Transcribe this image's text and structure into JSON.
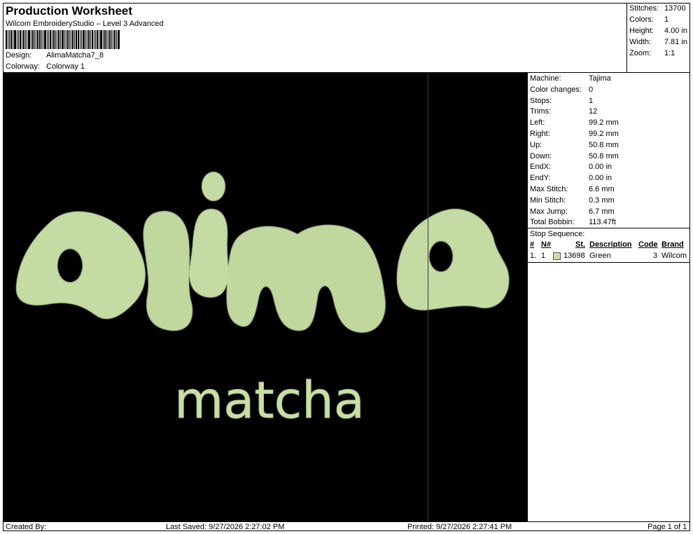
{
  "header": {
    "title": "Production Worksheet",
    "subtitle": "Wilcom EmbroideryStudio – Level 3 Advanced",
    "design_label": "Design:",
    "design_value": "AlimaMatcha7_8",
    "colorway_label": "Colorway:",
    "colorway_value": "Colorway 1"
  },
  "summary": {
    "stitches_label": "Stitches:",
    "stitches_value": "13700",
    "colors_label": "Colors:",
    "colors_value": "1",
    "height_label": "Height:",
    "height_value": "4.00 in",
    "width_label": "Width:",
    "width_value": "7.81 in",
    "zoom_label": "Zoom:",
    "zoom_value": "1:1"
  },
  "machine_info": [
    {
      "label": "Machine:",
      "value": "Tajima"
    },
    {
      "label": "Color changes:",
      "value": "0"
    },
    {
      "label": "Stops:",
      "value": "1"
    },
    {
      "label": "Trims:",
      "value": "12"
    },
    {
      "label": "Left:",
      "value": "99.2 mm"
    },
    {
      "label": "Right:",
      "value": "99.2 mm"
    },
    {
      "label": "Up:",
      "value": "50.8 mm"
    },
    {
      "label": "Down:",
      "value": "50.8 mm"
    },
    {
      "label": "EndX:",
      "value": "0.00 in"
    },
    {
      "label": "EndY:",
      "value": "0.00 in"
    },
    {
      "label": "Max Stitch:",
      "value": "6.6 mm"
    },
    {
      "label": "Min Stitch:",
      "value": "0.3 mm"
    },
    {
      "label": "Max Jump:",
      "value": "6.7 mm"
    },
    {
      "label": "Total Bobbin:",
      "value": "113.47ft"
    }
  ],
  "stop_sequence": {
    "title": "Stop Sequence:",
    "columns": [
      "#",
      "N#",
      "St.",
      "Description",
      "Code",
      "Brand"
    ],
    "rows": [
      {
        "index": "1.",
        "n": "1",
        "stitches": "13698",
        "description": "Green",
        "code": "3",
        "brand": "Wilcom",
        "swatch_color": "#c8dfa8"
      }
    ]
  },
  "design": {
    "main_text": "alima",
    "sub_text": "matcha",
    "thread_color": "#c8dfa8",
    "background_color": "#000000"
  },
  "footer": {
    "created_by": "Created By:",
    "last_saved": "Last Saved: 9/27/2026 2:27:02 PM",
    "printed": "Printed: 9/27/2026 2:27:41 PM",
    "page": "Page 1 of 1"
  }
}
